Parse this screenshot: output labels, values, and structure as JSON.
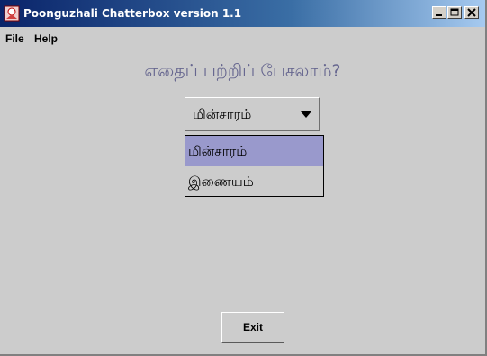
{
  "window": {
    "title": "Poonguzhali Chatterbox version 1.1",
    "controls": [
      "minimize-icon",
      "maximize-icon",
      "close-icon"
    ]
  },
  "menubar": {
    "items": [
      {
        "label": "File"
      },
      {
        "label": "Help"
      }
    ]
  },
  "main": {
    "heading": "எதைப் பற்றிப் பேசலாம்?",
    "topic_select": {
      "selected": "மின்சாரம்",
      "options": [
        {
          "label": "மின்சாரம்",
          "highlighted": true
        },
        {
          "label": "இணையம்",
          "highlighted": false
        }
      ]
    },
    "exit_label": "Exit"
  },
  "colors": {
    "title_gradient_start": "#0a246a",
    "title_gradient_end": "#a6caf0",
    "background": "#cccccc",
    "heading_text": "#66668f",
    "selection": "#9999cc"
  }
}
